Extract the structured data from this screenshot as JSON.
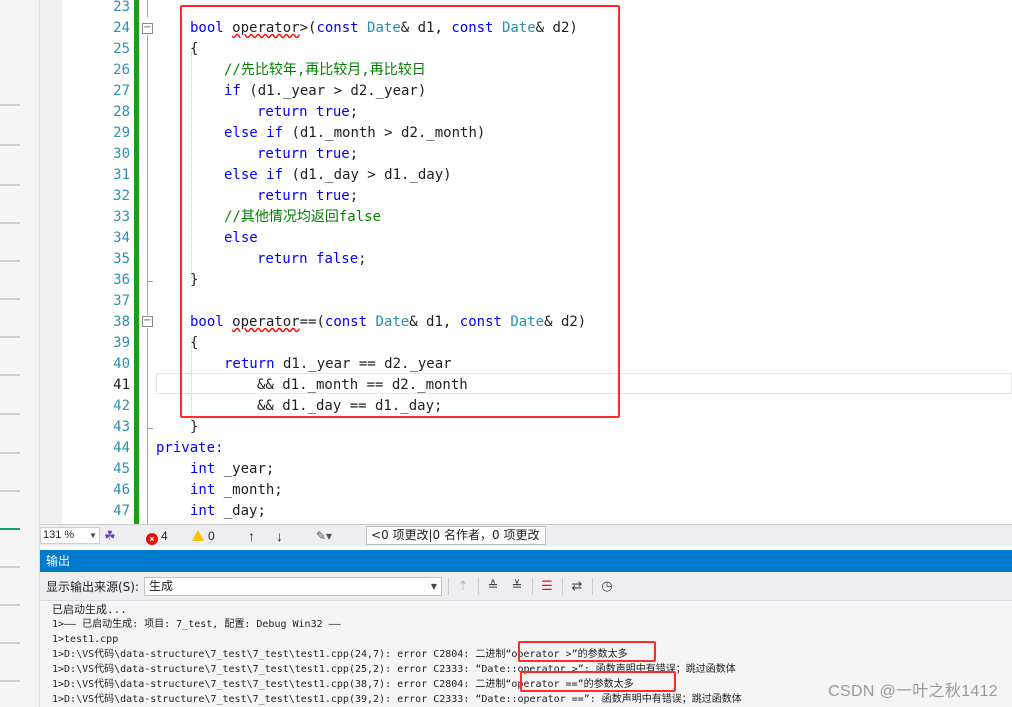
{
  "editor": {
    "line_numbers": [
      "23",
      "24",
      "25",
      "26",
      "27",
      "28",
      "29",
      "30",
      "31",
      "32",
      "33",
      "34",
      "35",
      "36",
      "37",
      "38",
      "39",
      "40",
      "41",
      "42",
      "43",
      "44",
      "45",
      "46",
      "47"
    ],
    "current_line": "41",
    "code": {
      "l24": {
        "kw_bool": "bool",
        "op": "operator",
        "rest1": ">(",
        "kw_const1": "const",
        "ty1": "Date",
        "rest2": "& d1, ",
        "kw_const2": "const",
        "ty2": "Date",
        "rest3": "& d2)"
      },
      "l25": "{",
      "l26": "//先比较年,再比较月,再比较日",
      "l27": {
        "kw": "if",
        "rest": " (d1._year > d2._year)"
      },
      "l28": {
        "kw": "return",
        "kw2": "true",
        "rest": ";"
      },
      "l29": {
        "kw": "else if",
        "rest": " (d1._month > d2._month)"
      },
      "l30": {
        "kw": "return",
        "kw2": "true",
        "rest": ";"
      },
      "l31": {
        "kw": "else if",
        "rest": " (d1._day > d1._day)"
      },
      "l32": {
        "kw": "return",
        "kw2": "true",
        "rest": ";"
      },
      "l33": "//其他情况均返回false",
      "l34": "else",
      "l35": {
        "kw": "return",
        "kw2": "false",
        "rest": ";"
      },
      "l36": "}",
      "l38": {
        "kw_bool": "bool",
        "op": "operator",
        "rest1": "==(",
        "kw_const1": "const",
        "ty1": "Date",
        "rest2": "& d1, ",
        "kw_const2": "const",
        "ty2": "Date",
        "rest3": "& d2)"
      },
      "l39": "{",
      "l40": {
        "kw": "return",
        "rest": " d1._year == d2._year"
      },
      "l41": "&& d1._month == d2._month",
      "l42": "&& d1._day == d1._day;",
      "l43": "}",
      "l44": "private:",
      "l45": {
        "kw": "int",
        "rest": " _year;"
      },
      "l46": {
        "kw": "int",
        "rest": " _month;"
      },
      "l47": {
        "kw": "int",
        "rest": " _day;"
      }
    }
  },
  "status": {
    "zoom": "131 %",
    "errors": "4",
    "warnings": "0",
    "up_arrow": "↑",
    "down_arrow": "↓",
    "changes": "0 项更改|0 名作者，0 项更改",
    "changes_arrow": "<"
  },
  "output": {
    "title": "输出",
    "source_label": "显示输出来源(S):",
    "source_value": "生成",
    "lines": [
      "已启动生成...",
      "1>—— 已启动生成: 项目: 7_test, 配置: Debug Win32 ——",
      "1>test1.cpp",
      "1>D:\\VS代码\\data-structure\\7_test\\7_test\\test1.cpp(24,7): error C2804: 二进制“operator >”的参数太多",
      "1>D:\\VS代码\\data-structure\\7_test\\7_test\\test1.cpp(25,2): error C2333: “Date::operator >”: 函数声明中有错误；跳过函数体",
      "1>D:\\VS代码\\data-structure\\7_test\\7_test\\test1.cpp(38,7): error C2804: 二进制“operator ==”的参数太多",
      "1>D:\\VS代码\\data-structure\\7_test\\7_test\\test1.cpp(39,2): error C2333: “Date::operator ==”: 函数声明中有错误；跳过函数体"
    ]
  },
  "colors": {
    "keyword": "#0000ff",
    "type": "#2b91af",
    "comment": "#008000",
    "highlight_box": "#ff2a2a",
    "change_bar": "#17a017",
    "accent": "#007acc"
  },
  "watermark": "CSDN @一叶之秋1412"
}
